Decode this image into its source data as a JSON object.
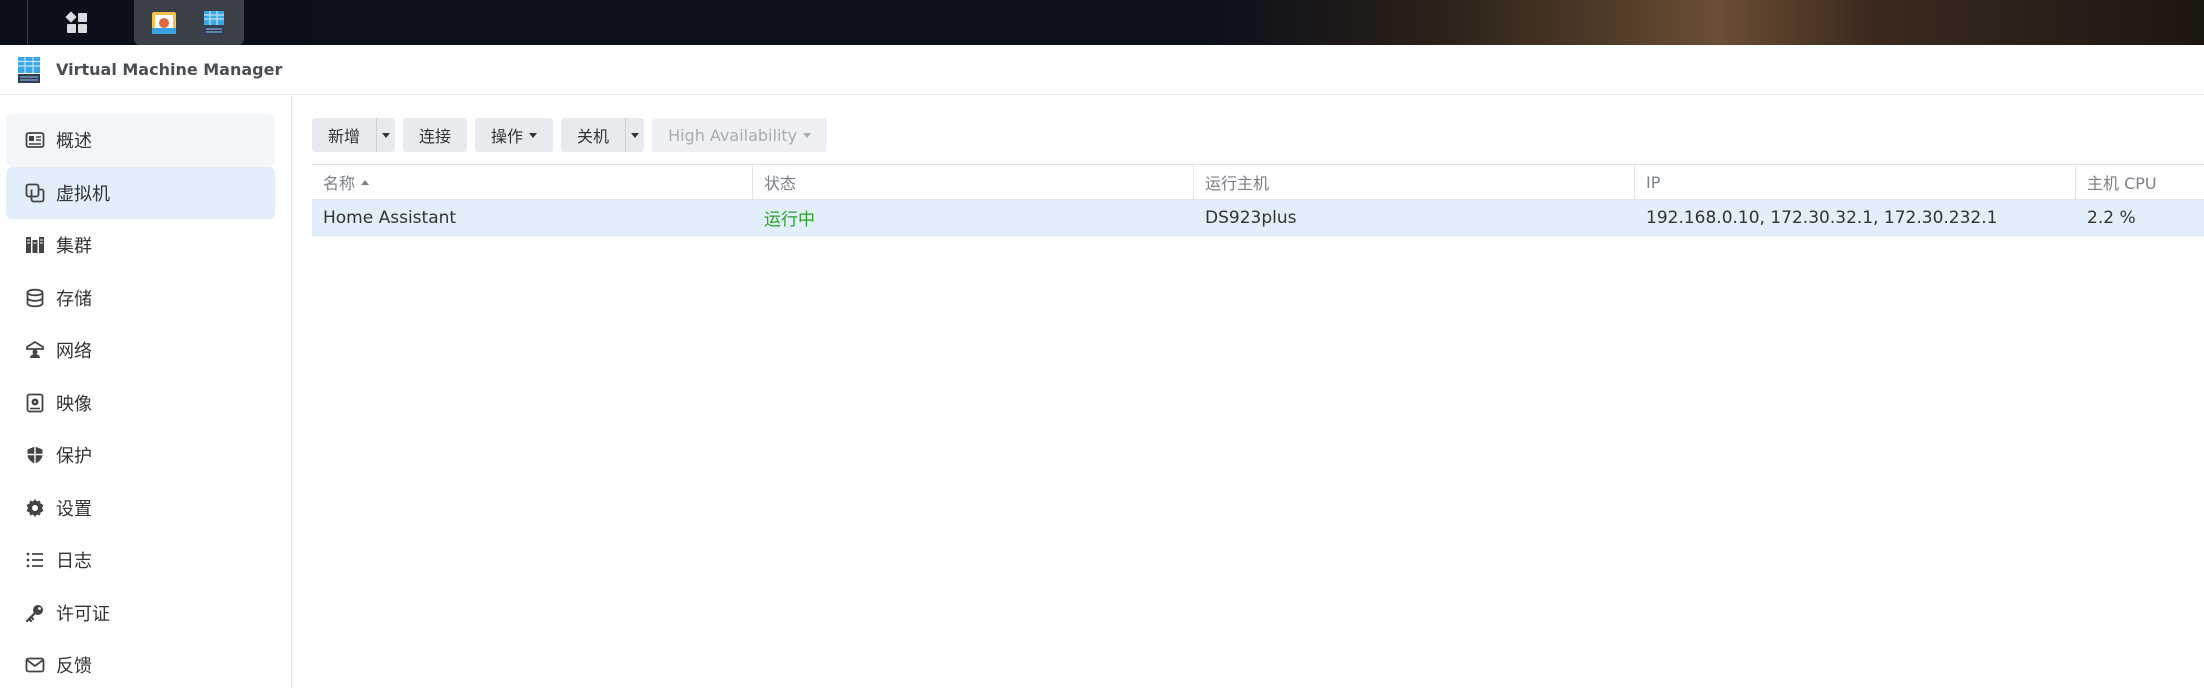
{
  "window": {
    "title": "Virtual Machine Manager"
  },
  "sidebar": {
    "items": [
      {
        "label": "概述",
        "icon": "overview-icon"
      },
      {
        "label": "虚拟机",
        "icon": "virtual-machine-icon"
      },
      {
        "label": "集群",
        "icon": "cluster-icon"
      },
      {
        "label": "存储",
        "icon": "storage-icon"
      },
      {
        "label": "网络",
        "icon": "network-icon"
      },
      {
        "label": "映像",
        "icon": "image-icon"
      },
      {
        "label": "保护",
        "icon": "shield-icon"
      },
      {
        "label": "设置",
        "icon": "gear-icon"
      },
      {
        "label": "日志",
        "icon": "list-icon"
      },
      {
        "label": "许可证",
        "icon": "key-icon"
      },
      {
        "label": "反馈",
        "icon": "envelope-icon"
      }
    ]
  },
  "toolbar": {
    "create_label": "新增",
    "connect_label": "连接",
    "action_label": "操作",
    "shutdown_label": "关机",
    "ha_label": "High Availability"
  },
  "table": {
    "columns": [
      "名称",
      "状态",
      "运行主机",
      "IP",
      "主机 CPU"
    ],
    "rows": [
      {
        "name": "Home Assistant",
        "status": "运行中",
        "host": "DS923plus",
        "ip": "192.168.0.10, 172.30.32.1, 172.30.232.1",
        "cpu": "2.2 %"
      }
    ]
  },
  "colors": {
    "accent": "#e2eefa",
    "running": "#2aa32a",
    "button": "#e7eaee"
  }
}
